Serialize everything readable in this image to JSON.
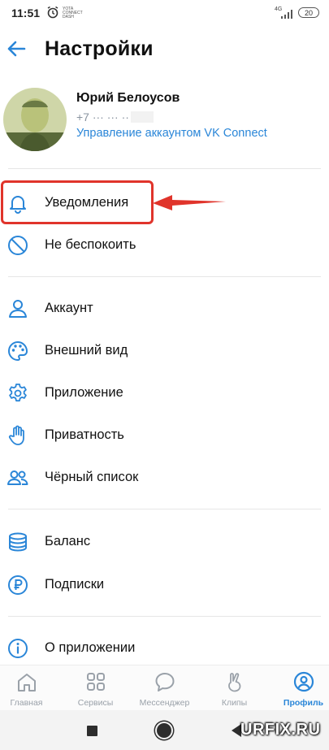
{
  "status_bar": {
    "time": "11:51",
    "tiny_text": "YOTA CONNECT DASH",
    "network": "4G",
    "battery": "20"
  },
  "header": {
    "title": "Настройки",
    "back_icon": "arrow-left-icon"
  },
  "profile": {
    "name": "Юрий Белоусов",
    "phone": "+7 ··· ··· ··",
    "manage_link": "Управление аккаунтом VK Connect"
  },
  "groups": [
    {
      "items": [
        {
          "label": "Уведомления",
          "icon": "bell-icon",
          "highlighted": true
        },
        {
          "label": "Не беспокоить",
          "icon": "do-not-disturb-icon"
        }
      ]
    },
    {
      "items": [
        {
          "label": "Аккаунт",
          "icon": "user-icon"
        },
        {
          "label": "Внешний вид",
          "icon": "palette-icon"
        },
        {
          "label": "Приложение",
          "icon": "gear-icon"
        },
        {
          "label": "Приватность",
          "icon": "hand-icon"
        },
        {
          "label": "Чёрный список",
          "icon": "users-icon"
        }
      ]
    },
    {
      "items": [
        {
          "label": "Баланс",
          "icon": "coins-icon"
        },
        {
          "label": "Подписки",
          "icon": "ruble-icon"
        }
      ]
    },
    {
      "items": [
        {
          "label": "О приложении",
          "icon": "info-icon"
        }
      ]
    }
  ],
  "tabs": [
    {
      "label": "Главная",
      "icon": "home-icon",
      "active": false
    },
    {
      "label": "Сервисы",
      "icon": "services-icon",
      "active": false
    },
    {
      "label": "Мессенджер",
      "icon": "messenger-icon",
      "active": false
    },
    {
      "label": "Клипы",
      "icon": "clips-icon",
      "active": false
    },
    {
      "label": "Профиль",
      "icon": "profile-icon",
      "active": true
    }
  ],
  "watermark": "URFIX.RU",
  "colors": {
    "accent": "#2a86d8",
    "highlight": "#e0342b",
    "icon": "#2a86d8"
  }
}
